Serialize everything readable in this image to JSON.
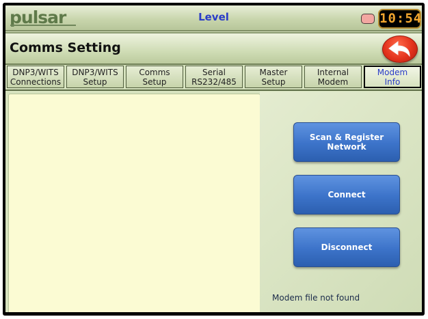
{
  "header": {
    "logo_text": "pulsar",
    "title": "Level",
    "clock": "10:54",
    "icons": [
      "status-indicator-icon"
    ]
  },
  "page": {
    "title": "Comms Setting",
    "back_icon": "back-arrow-icon",
    "back_color": "#e3321c"
  },
  "tabs": [
    {
      "line1": "DNP3/WITS",
      "line2": "Connections"
    },
    {
      "line1": "DNP3/WITS",
      "line2": "Setup"
    },
    {
      "line1": "Comms",
      "line2": "Setup"
    },
    {
      "line1": "Serial",
      "line2": "RS232/485"
    },
    {
      "line1": "Master",
      "line2": "Setup"
    },
    {
      "line1": "Internal",
      "line2": "Modem"
    },
    {
      "line1": "Modem",
      "line2": "Info",
      "active": true
    }
  ],
  "actions": {
    "scan_line1": "Scan & Register",
    "scan_line2": "Network",
    "connect": "Connect",
    "disconnect": "Disconnect"
  },
  "status": "Modem file not found",
  "colors": {
    "accent": "#2a3cc8",
    "button_blue": "#3c73c9",
    "panel_bg": "#fbfbd3",
    "clock_digits": "#f2a62f"
  }
}
